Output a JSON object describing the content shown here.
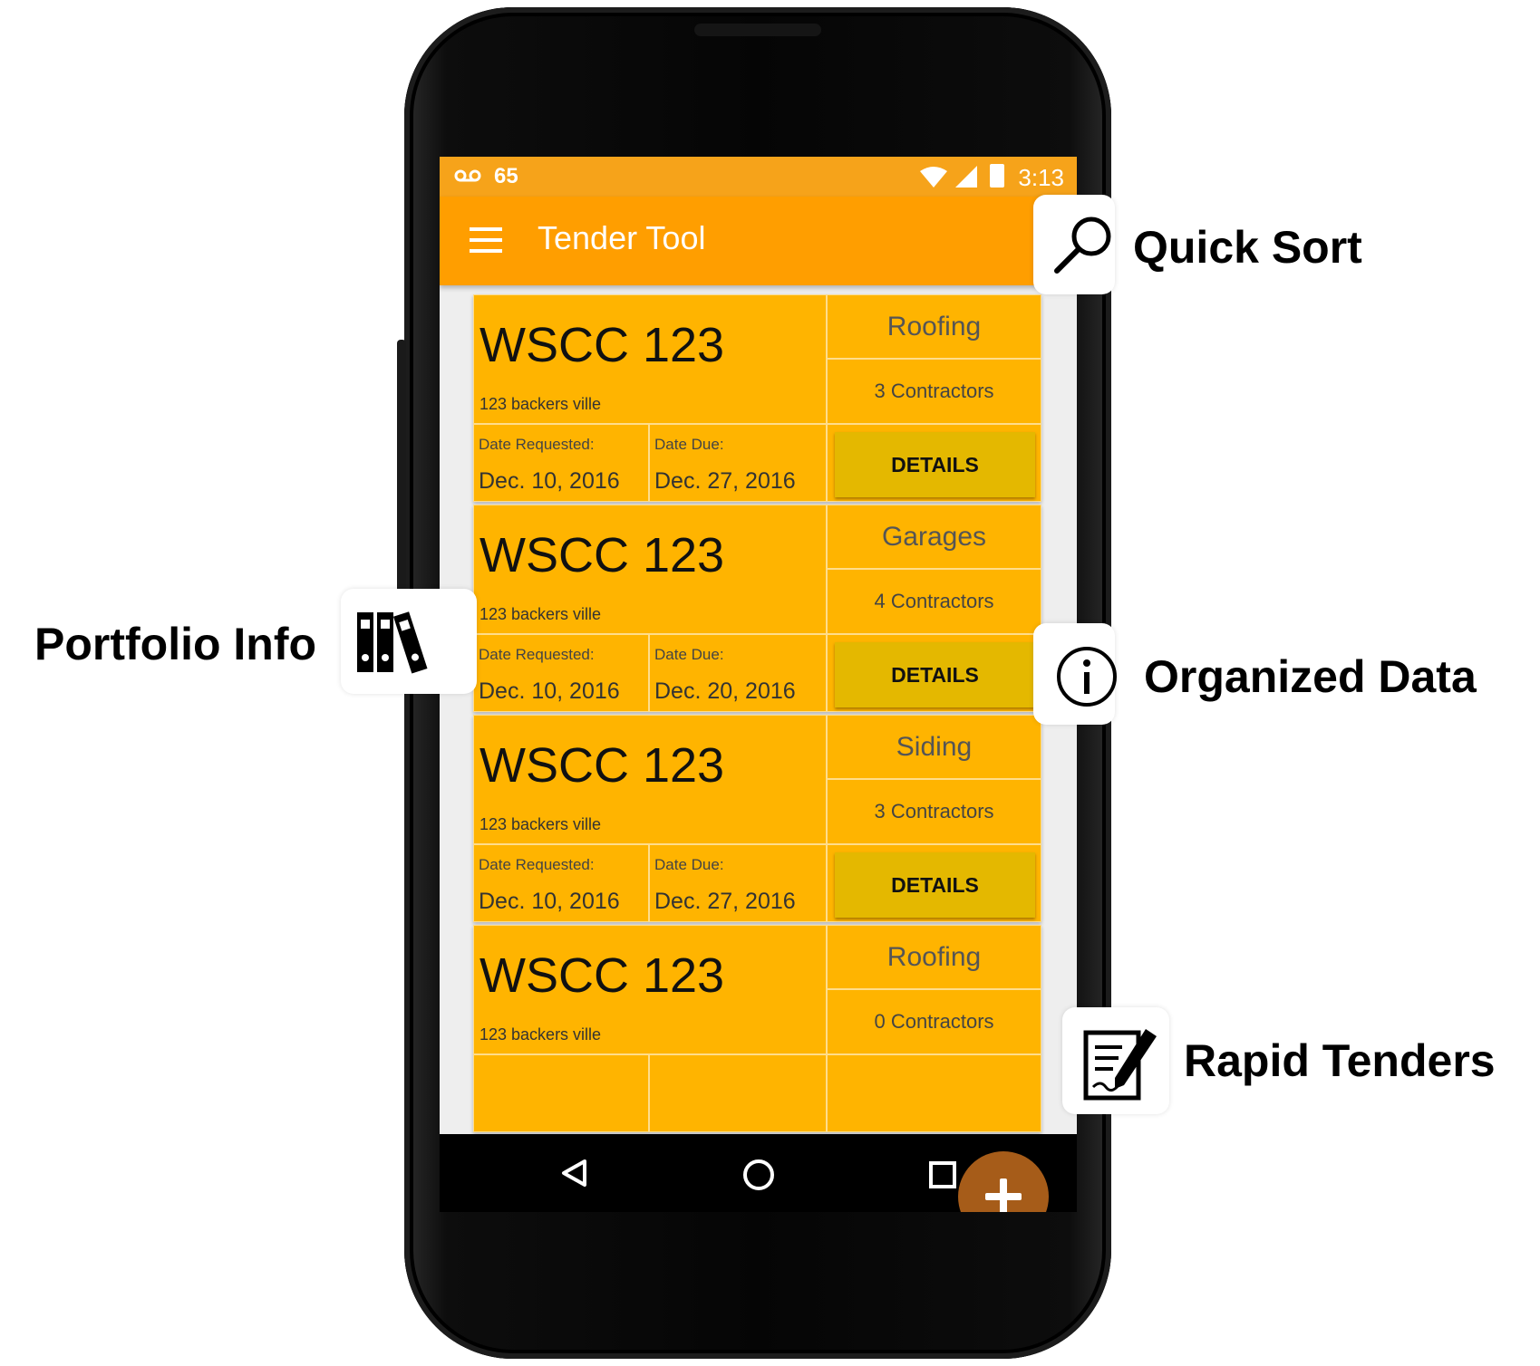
{
  "status_bar": {
    "signal_text": "65",
    "time": "3:13"
  },
  "app_bar": {
    "title": "Tender Tool",
    "menu_icon": "hamburger-menu-icon"
  },
  "tenders": [
    {
      "code": "WSCC 123",
      "address": "123 backers ville",
      "date_requested_label": "Date Requested:",
      "date_requested": "Dec. 10, 2016",
      "date_due_label": "Date Due:",
      "date_due": "Dec. 27, 2016",
      "type": "Roofing",
      "contractors": "3 Contractors",
      "details_label": "DETAILS"
    },
    {
      "code": "WSCC 123",
      "address": "123 backers ville",
      "date_requested_label": "Date Requested:",
      "date_requested": "Dec. 10, 2016",
      "date_due_label": "Date Due:",
      "date_due": "Dec. 20, 2016",
      "type": "Garages",
      "contractors": "4 Contractors",
      "details_label": "DETAILS"
    },
    {
      "code": "WSCC 123",
      "address": "123 backers ville",
      "date_requested_label": "Date Requested:",
      "date_requested": "Dec. 10, 2016",
      "date_due_label": "Date Due:",
      "date_due": "Dec. 27, 2016",
      "type": "Siding",
      "contractors": "3 Contractors",
      "details_label": "DETAILS"
    },
    {
      "code": "WSCC 123",
      "address": "123 backers ville",
      "type": "Roofing",
      "contractors": "0 Contractors"
    }
  ],
  "callouts": {
    "quick_sort": "Quick Sort",
    "portfolio_info": "Portfolio Info",
    "organized_data": "Organized Data",
    "rapid_tenders": "Rapid Tenders"
  },
  "colors": {
    "status_bar": "#f6a31a",
    "app_bar": "#ff9e00",
    "card": "#ffb400",
    "details_button": "#e4b800",
    "fab": "#a65c19"
  },
  "icons": [
    "voicemail-icon",
    "wifi-icon",
    "cell-signal-icon",
    "battery-icon",
    "hamburger-menu-icon",
    "search-icon",
    "binders-icon",
    "info-icon",
    "signed-document-icon",
    "add-icon",
    "back-icon",
    "home-icon",
    "recents-icon"
  ]
}
